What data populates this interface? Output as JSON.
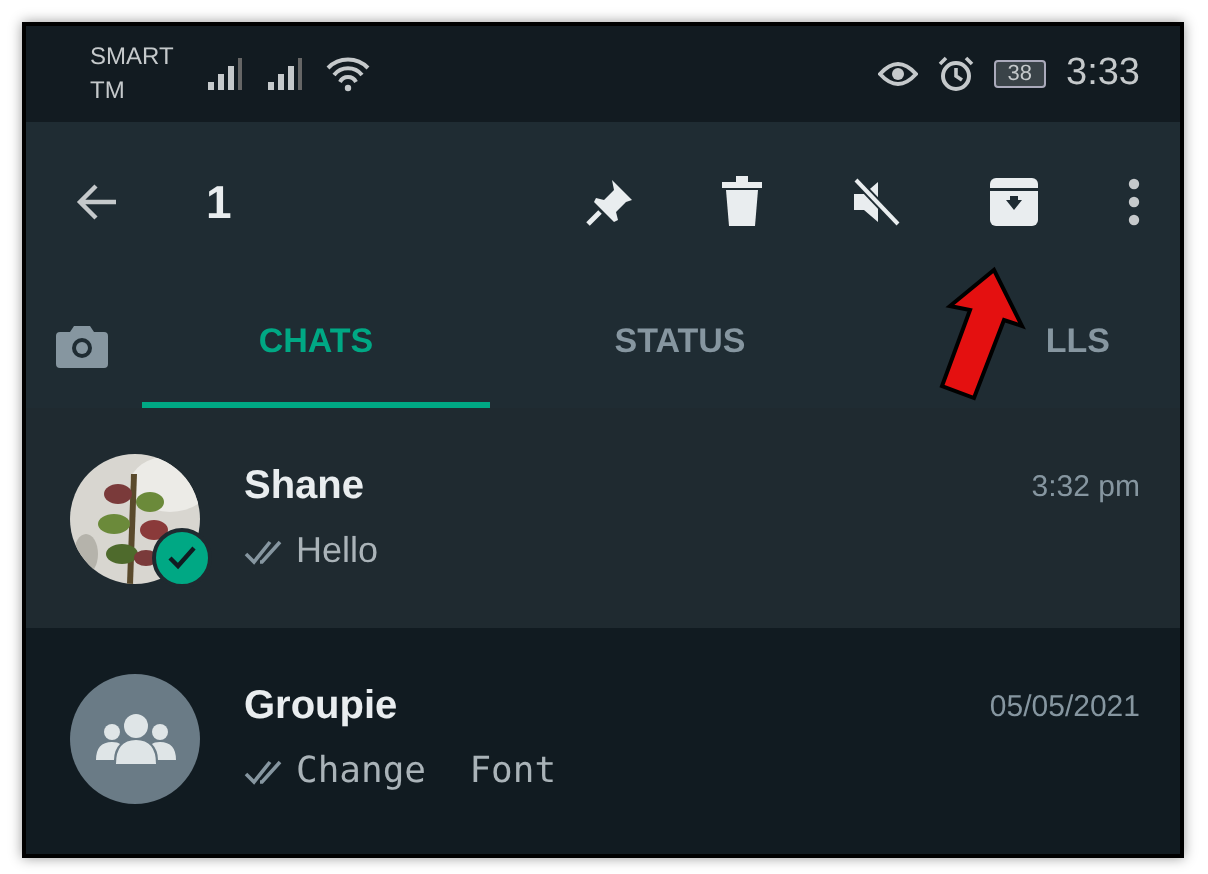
{
  "status_bar": {
    "carrier": [
      "SMART",
      "TM"
    ],
    "battery": "38",
    "time": "3:33"
  },
  "toolbar": {
    "count": "1"
  },
  "tabs": [
    {
      "label": "CHATS",
      "selected": true
    },
    {
      "label": "STATUS",
      "selected": false
    },
    {
      "label": "LLS",
      "selected": false
    }
  ],
  "chats": [
    {
      "name": "Shane",
      "time": "3:32 pm",
      "message": "Hello",
      "selected": true,
      "kind": "picture"
    },
    {
      "name": "Groupie",
      "time": "05/05/2021",
      "message": "Change  Font",
      "selected": false,
      "kind": "group"
    }
  ]
}
